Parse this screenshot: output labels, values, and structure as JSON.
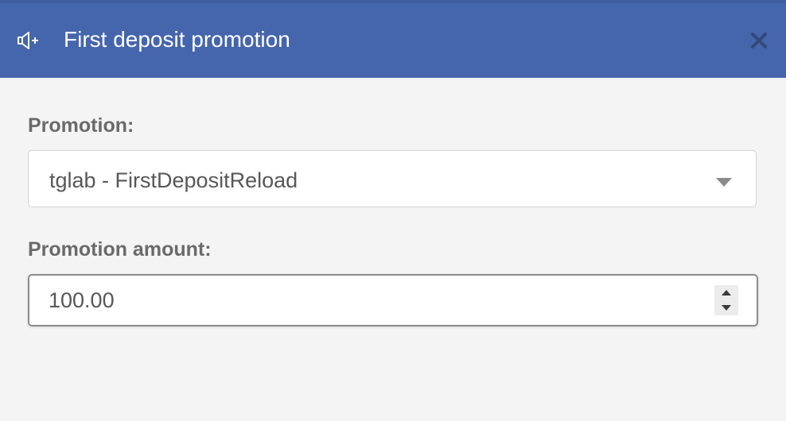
{
  "dialog": {
    "title": "First deposit promotion",
    "header_icon": "megaphone-plus-icon",
    "close_icon": "close-icon"
  },
  "colors": {
    "header_bg": "#4566ad",
    "body_bg": "#f4f4f4",
    "label_text": "#6a6a6a",
    "input_text": "#575757"
  },
  "form": {
    "promotion_label": "Promotion:",
    "promotion_selected": "tglab - FirstDepositReload",
    "amount_label": "Promotion amount:",
    "amount_value": "100.00"
  }
}
